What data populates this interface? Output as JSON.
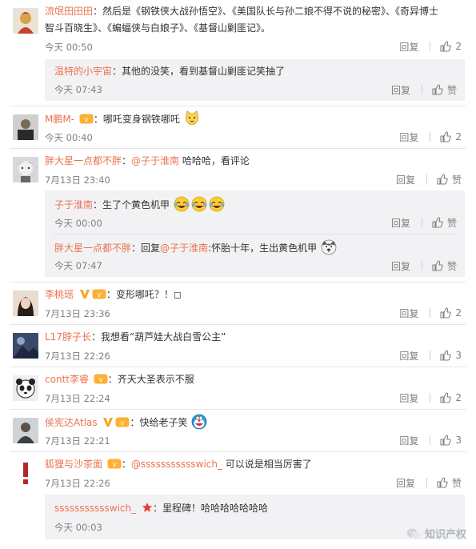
{
  "comments": [
    {
      "user": "流氓田田田",
      "text": "：然后是《钢铁侠大战孙悟空》、《美国队长与孙二娘不得不说的秘密》、《奇异博士",
      "text2": "智斗百晓生》、《蝙蝠侠与白娘子》、《基督山剿匪记》。",
      "time": "今天 00:50",
      "reply": "回复",
      "likes": "2"
    },
    {
      "user": "温特的小宇宙",
      "text": "：其他的没笑，看到基督山剿匪记笑抽了",
      "time": "今天 07:43",
      "reply": "回复",
      "likes": "赞"
    },
    {
      "user": "M鹏M-",
      "text": "：哪吒变身钢铁哪吒",
      "time": "今天 00:40",
      "reply": "回复",
      "likes": "2"
    },
    {
      "user": "胖大星一点都不胖",
      "text_prefix": "：",
      "at": "@子于淮南",
      "text": " 哈哈哈，看评论",
      "time": "7月13日 23:40",
      "reply": "回复",
      "likes": "赞"
    },
    {
      "user": "子于淮南",
      "text": "：生了个黄色机甲",
      "time": "今天 00:00",
      "reply": "回复",
      "likes": "赞"
    },
    {
      "user": "胖大星一点都不胖",
      "text_prefix": "：回复",
      "at": "@子于淮南",
      "text": ":怀胎十年，生出黄色机甲",
      "time": "今天 07:47",
      "reply": "回复",
      "likes": "赞"
    },
    {
      "user": "李桃瑶",
      "text": "：变形哪吒？！◻",
      "time": "7月13日 23:36",
      "reply": "回复",
      "likes": "2"
    },
    {
      "user": "L17脖子长",
      "text": "：我想看“葫芦娃大战白雪公主”",
      "time": "7月13日 22:26",
      "reply": "回复",
      "likes": "3"
    },
    {
      "user": "contt李睿",
      "text": "：齐天大圣表示不服",
      "time": "7月13日 22:24",
      "reply": "回复",
      "likes": "2"
    },
    {
      "user": "侯宪达Atlas",
      "text": "：快给老子笑",
      "time": "7月13日 22:21",
      "reply": "回复",
      "likes": "3"
    },
    {
      "user": "狐狸与沙茶面",
      "text_prefix": "：",
      "at": "@ssssssssssswich_",
      "text": " 可以说是相当厉害了",
      "time": "7月13日 22:26",
      "reply": "回复",
      "likes": "赞"
    },
    {
      "user": "ssssssssssswich_",
      "text": "：里程碑！哈哈哈哈哈哈哈",
      "time": "今天 00:03",
      "reply": "回复",
      "likes": "赞"
    }
  ],
  "watermark": "知识产权",
  "colors": {
    "accent": "#eb7350",
    "muted": "#808080",
    "subbg": "#f2f2f5"
  }
}
